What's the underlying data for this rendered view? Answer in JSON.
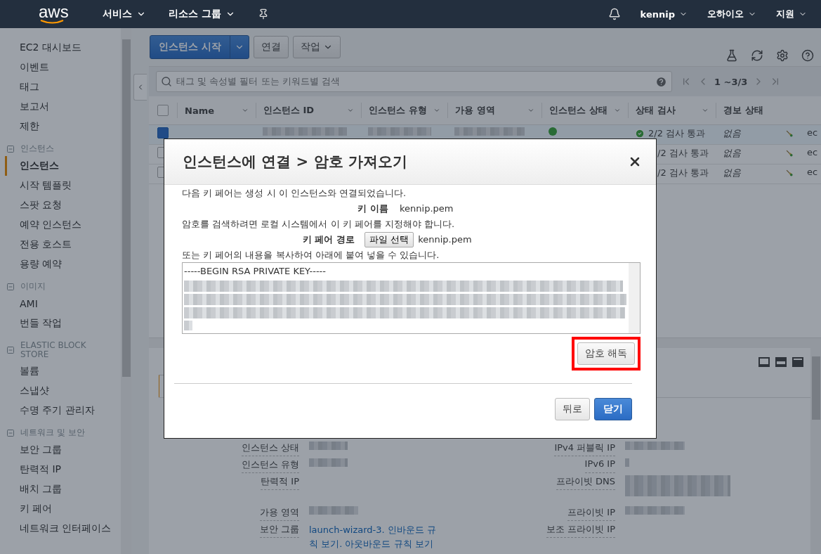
{
  "topbar": {
    "logo": "aws",
    "menus": [
      {
        "label": "서비스"
      },
      {
        "label": "리소스 그룹"
      }
    ],
    "user": "kennip",
    "region": "오하이오",
    "support": "지원"
  },
  "sidebar": {
    "items": [
      {
        "label": "EC2 대시보드",
        "selected": false
      },
      {
        "label": "이벤트",
        "selected": false
      },
      {
        "label": "태그",
        "selected": false
      },
      {
        "label": "보고서",
        "selected": false
      },
      {
        "label": "제한",
        "selected": false
      }
    ],
    "sections": [
      {
        "title": "인스턴스",
        "expanded": true,
        "items": [
          {
            "label": "인스턴스",
            "selected": true
          },
          {
            "label": "시작 템플릿",
            "selected": false
          },
          {
            "label": "스팟 요청",
            "selected": false
          },
          {
            "label": "예약 인스턴스",
            "selected": false
          },
          {
            "label": "전용 호스트",
            "selected": false
          },
          {
            "label": "용량 예약",
            "selected": false
          }
        ]
      },
      {
        "title": "이미지",
        "expanded": true,
        "items": [
          {
            "label": "AMI",
            "selected": false
          },
          {
            "label": "번들 작업",
            "selected": false
          }
        ]
      },
      {
        "title": "ELASTIC BLOCK STORE",
        "expanded": true,
        "items": [
          {
            "label": "볼륨",
            "selected": false
          },
          {
            "label": "스냅샷",
            "selected": false
          },
          {
            "label": "수명 주기 관리자",
            "selected": false
          }
        ]
      },
      {
        "title": "네트워크 및 보안",
        "expanded": true,
        "items": [
          {
            "label": "보안 그룹",
            "selected": false
          },
          {
            "label": "탄력적 IP",
            "selected": false
          },
          {
            "label": "배치 그룹",
            "selected": false
          },
          {
            "label": "키 페어",
            "selected": false
          },
          {
            "label": "네트워크 인터페이스",
            "selected": false
          }
        ]
      }
    ]
  },
  "toolbar": {
    "launch_button": "인스턴스 시작",
    "connect_button": "연결",
    "actions_button": "작업"
  },
  "search": {
    "placeholder": "태그 및 속성별 필터 또는 키워드별 검색",
    "pagination": "1 ~3/3"
  },
  "table": {
    "columns": [
      "Name",
      "인스턴스 ID",
      "인스턴스 유형",
      "가용 영역",
      "인스턴스 상태",
      "상태 검사",
      "경보 상태"
    ],
    "rows": [
      {
        "selected": true,
        "masked": true,
        "check": "2/2 검사 통과",
        "alarm": "없음",
        "column_8": "ec"
      },
      {
        "selected": false,
        "check": "/2 검사 통과",
        "alarm": "없음",
        "column_8": "ec"
      },
      {
        "selected": false,
        "check": "/2 검사 통과",
        "alarm": "없음",
        "column_8": "ec"
      }
    ],
    "all_selected": false
  },
  "details": {
    "left": [
      {
        "label": "인스턴스 상태",
        "masked": true
      },
      {
        "label": "인스턴스 유형",
        "masked": true
      },
      {
        "label": "탄력적 IP"
      },
      {
        "label": "가용 영역",
        "masked": true
      },
      {
        "label": "보안 그룹",
        "link": "launch-wizard-3. 인바운드 규칙 보기. 아웃바운드 규칙 보기"
      }
    ],
    "right": [
      {
        "label": "IPv4 퍼블릭 IP",
        "masked": true
      },
      {
        "label": "IPv6 IP",
        "masked": true
      },
      {
        "label": "프라이빗 DNS",
        "masked": true
      },
      {
        "label": "프라이빗 IP",
        "masked": true
      },
      {
        "label": "보조 프라이빗 IP"
      }
    ]
  },
  "dialog": {
    "title": "인스턴스에 연결 > 암호 가져오기",
    "intro": "다음 키 페어는 생성 시 이 인스턴스와 연결되었습니다.",
    "key_name_label": "키 이름",
    "key_name": "kennip.pem",
    "instruction": "암호를 검색하려면 로컬 시스템에서 이 키 페어를 지정해야 합니다.",
    "key_path_label": "키 페어 경로",
    "file_button": "파일 선택",
    "file_name": "kennip.pem",
    "paste_hint": "또는 키 페어의 내용을 복사하여 아래에 붙여 넣을 수 있습니다.",
    "key_text": "-----BEGIN RSA PRIVATE KEY-----",
    "decrypt_button": "암호 해독",
    "decrypt_highlighted": true,
    "back_button": "뒤로",
    "close_button": "닫기"
  }
}
